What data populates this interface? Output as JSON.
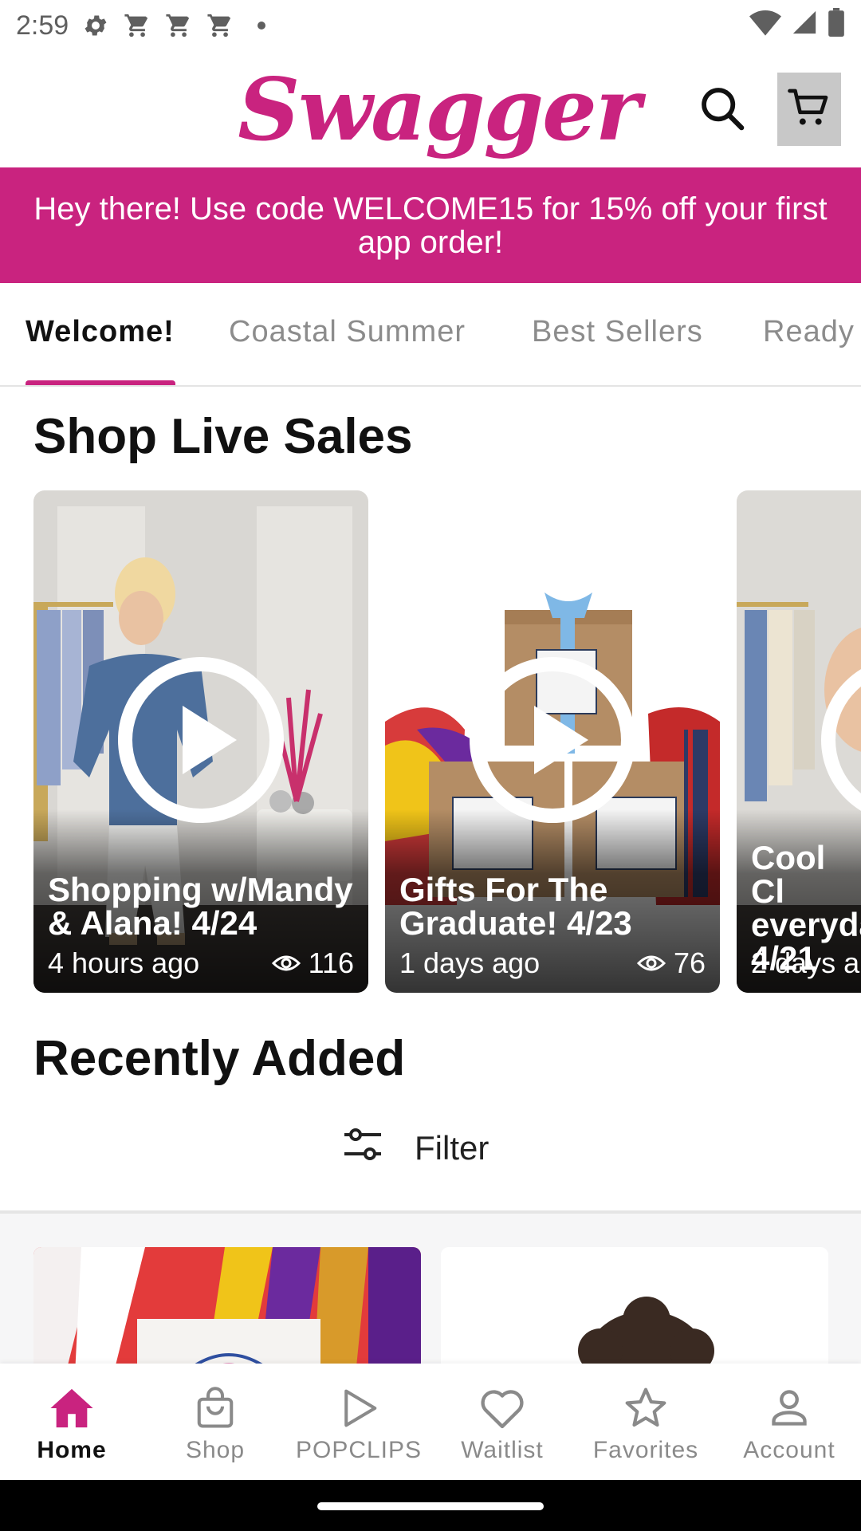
{
  "status_bar": {
    "time": "2:59",
    "left_icons": [
      "settings-icon",
      "cart-notification-icon",
      "cart-notification-icon",
      "cart-notification-icon",
      "dot-icon"
    ],
    "right_icons": [
      "wifi-icon",
      "signal-icon",
      "battery-icon"
    ]
  },
  "header": {
    "logo_text": "Swagger",
    "search_icon": "search-icon",
    "cart_icon": "cart-icon"
  },
  "promo": {
    "text": "Hey there! Use code WELCOME15 for 15% off your first app order!"
  },
  "tabs": [
    {
      "label": "Welcome!",
      "active": true
    },
    {
      "label": "Coastal Summer",
      "active": false
    },
    {
      "label": "Best Sellers",
      "active": false
    },
    {
      "label": "Ready",
      "active": false
    }
  ],
  "live_sales": {
    "title": "Shop Live Sales",
    "cards": [
      {
        "title": "Shopping w/Mandy & Alana! 4/24",
        "time": "4 hours ago",
        "views": "116"
      },
      {
        "title": "Gifts For The Graduate!  4/23",
        "time": "1 days ago",
        "views": "76"
      },
      {
        "title": "Cool Cl everyda 4/21",
        "time": "2 days a",
        "views": ""
      }
    ]
  },
  "recently_added": {
    "title": "Recently Added",
    "filter_label": "Filter"
  },
  "bottom_nav": [
    {
      "label": "Home",
      "icon": "home-icon",
      "active": true
    },
    {
      "label": "Shop",
      "icon": "shopping-bag-icon",
      "active": false
    },
    {
      "label": "POPCLIPS",
      "icon": "play-icon",
      "active": false
    },
    {
      "label": "Waitlist",
      "icon": "heart-icon",
      "active": false
    },
    {
      "label": "Favorites",
      "icon": "star-icon",
      "active": false
    },
    {
      "label": "Account",
      "icon": "person-icon",
      "active": false
    }
  ],
  "colors": {
    "brand": "#c9237f",
    "inactive": "#8a8a8a"
  }
}
